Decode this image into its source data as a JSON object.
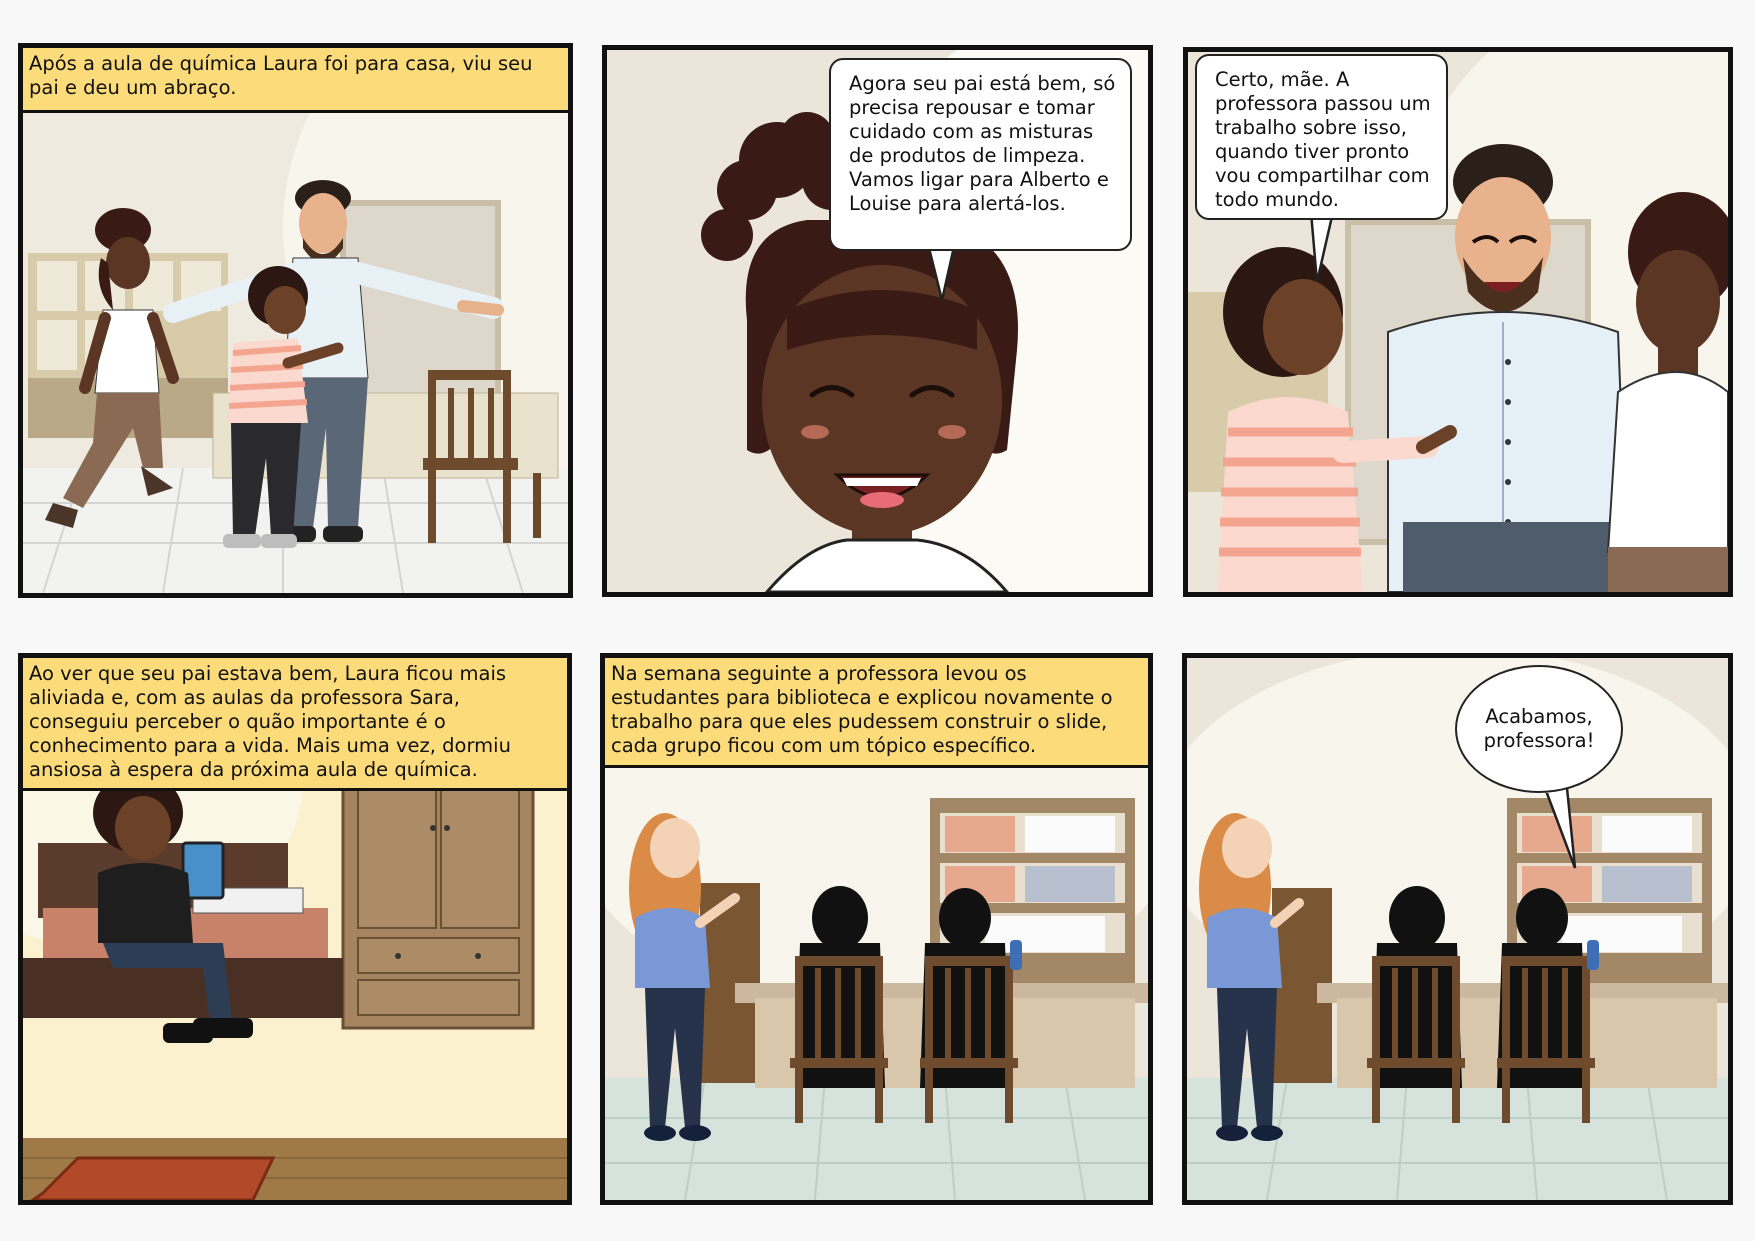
{
  "panels": [
    {
      "caption": "Após a aula de química Laura foi para casa, viu seu pai e deu um abraço."
    },
    {
      "speech": "Agora seu pai está bem, só precisa repousar e tomar cuidado com as misturas de produtos de limpeza. Vamos ligar para Alberto e Louise para alertá-los."
    },
    {
      "speech": "Certo, mãe. A professora passou um trabalho sobre isso, quando tiver pronto vou compartilhar com todo mundo."
    },
    {
      "caption": "Ao ver que seu pai estava bem, Laura ficou mais aliviada e, com as aulas da professora Sara, conseguiu perceber o quão importante é o conhecimento para a vida. Mais uma vez, dormiu ansiosa à espera da próxima aula de química."
    },
    {
      "caption": "Na semana seguinte a professora levou os estudantes para biblioteca e explicou novamente o trabalho para que eles pudessem construir o slide, cada grupo ficou com um tópico específico."
    },
    {
      "speech": "Acabamos, professora!"
    }
  ],
  "colors": {
    "caption_bg": "#fcdb7a",
    "panel_border": "#111111",
    "skin_dark": "#5b3624",
    "hair_dark": "#3a1a14",
    "teacher_hair": "#d98b47",
    "teacher_shirt": "#7b98d6"
  }
}
